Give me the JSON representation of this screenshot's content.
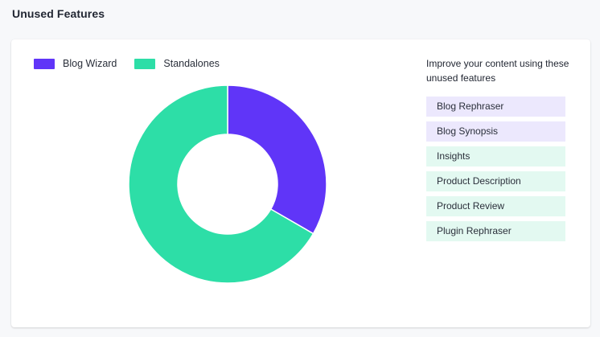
{
  "page": {
    "title": "Unused Features"
  },
  "colors": {
    "blog_wizard": "#6035f8",
    "standalones": "#2ddea7",
    "blog_item_bg": "#ece8fd",
    "standalone_item_bg": "#e3f9f1"
  },
  "chart_data": {
    "type": "pie",
    "categories": [
      "Blog Wizard",
      "Standalones"
    ],
    "values": [
      2,
      4
    ],
    "legend_position": "top-left"
  },
  "sidebar": {
    "heading": "Improve your content using these unused features",
    "items": [
      {
        "label": "Blog Rephraser",
        "group": "Blog Wizard"
      },
      {
        "label": "Blog Synopsis",
        "group": "Blog Wizard"
      },
      {
        "label": "Insights",
        "group": "Standalones"
      },
      {
        "label": "Product Description",
        "group": "Standalones"
      },
      {
        "label": "Product Review",
        "group": "Standalones"
      },
      {
        "label": "Plugin Rephraser",
        "group": "Standalones"
      }
    ]
  }
}
